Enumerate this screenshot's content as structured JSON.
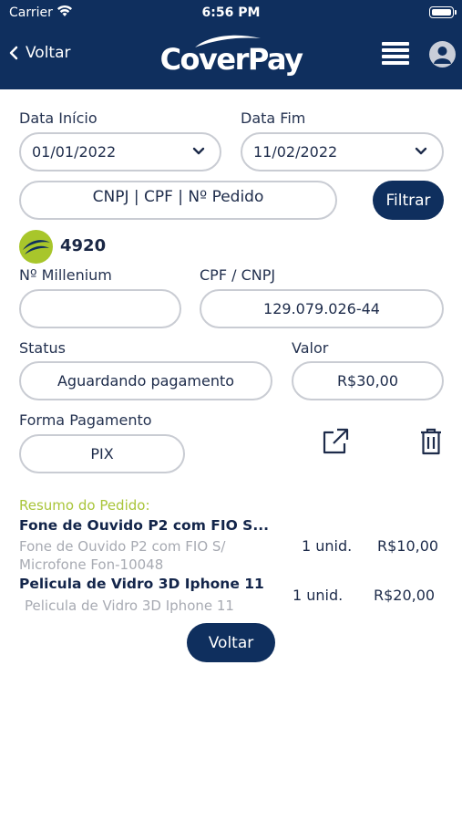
{
  "status_bar": {
    "carrier": "Carrier",
    "time": "6:56 PM"
  },
  "header": {
    "back_label": "Voltar",
    "logo_text": "CoverPay"
  },
  "filters": {
    "start_label": "Data Início",
    "start_value": "01/01/2022",
    "end_label": "Data Fim",
    "end_value": "11/02/2022",
    "search_placeholder": "CNPJ | CPF | Nº Pedido",
    "filter_button": "Filtrar"
  },
  "order": {
    "number": "4920",
    "millenium_label": "Nº Millenium",
    "millenium_value": "",
    "doc_label": "CPF / CNPJ",
    "doc_value": "129.079.026-44",
    "status_label": "Status",
    "status_value": "Aguardando pagamento",
    "value_label": "Valor",
    "value_value": "R$30,00",
    "payment_label": "Forma Pagamento",
    "payment_value": "PIX"
  },
  "summary": {
    "title": "Resumo do Pedido:",
    "items": [
      {
        "name": "Fone de Ouvido P2 com FIO S...",
        "desc_line1": "Fone de Ouvido P2 com FIO S/",
        "desc_line2": "Microfone Fon-10048",
        "qty": "1 unid.",
        "price": "R$10,00"
      },
      {
        "name": "Pelicula de Vidro 3D Iphone 11",
        "desc_line1": "Pelicula de Vidro 3D Iphone 11",
        "qty": "1 unid.",
        "price": "R$20,00"
      }
    ]
  },
  "footer": {
    "back_button": "Voltar"
  },
  "colors": {
    "navy": "#0f2f5e",
    "accent_green": "#a9c53a",
    "field_border": "#c9ccd3"
  },
  "icons": [
    "wifi-icon",
    "battery-icon",
    "chevron-left-icon",
    "menu-icon",
    "user-icon",
    "chevron-down-icon",
    "external-link-icon",
    "trash-icon"
  ]
}
